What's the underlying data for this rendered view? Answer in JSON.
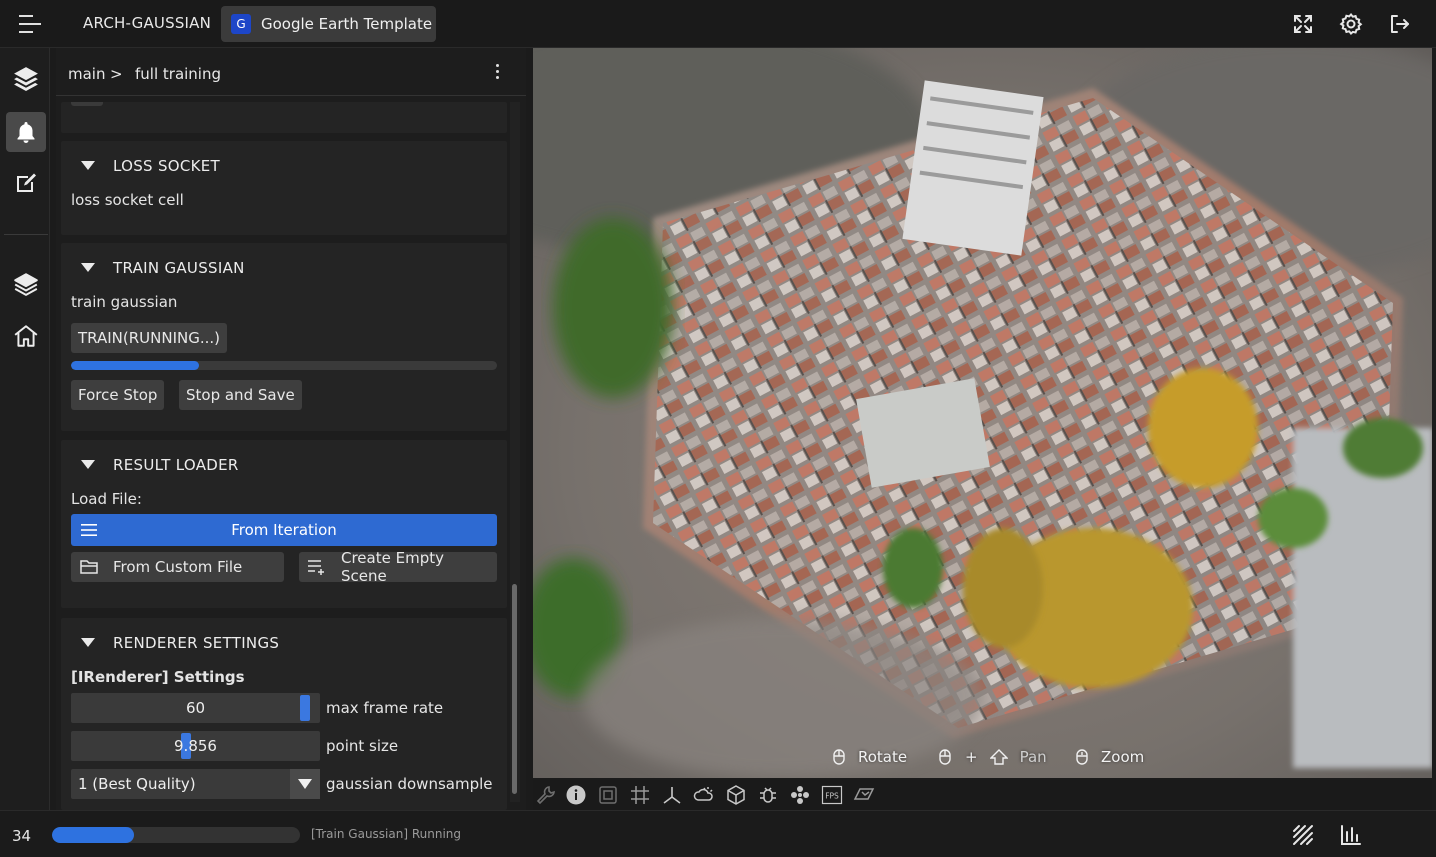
{
  "topbar": {
    "app_title": "ARCH-GAUSSIAN",
    "project_badge": "G",
    "project_name": "Google Earth Template",
    "icons": [
      "menu-icon",
      "fullscreen-icon",
      "gear-icon",
      "logout-icon"
    ]
  },
  "rail": {
    "items": [
      {
        "icon": "layers-icon",
        "active": false
      },
      {
        "icon": "bell-icon",
        "active": true
      },
      {
        "icon": "edit-icon",
        "active": false
      },
      {
        "icon": "layers-icon",
        "active": false
      },
      {
        "icon": "home-icon",
        "active": false
      }
    ]
  },
  "breadcrumb": {
    "root": "main",
    "separator": ">",
    "leaf": "full training"
  },
  "sections": {
    "loss_socket": {
      "title": "LOSS SOCKET",
      "text": "loss socket cell"
    },
    "train_gaussian": {
      "title": "TRAIN GAUSSIAN",
      "text": "train gaussian",
      "train_button": "TRAIN(RUNNING...)",
      "progress": 0.3,
      "force_stop": "Force Stop",
      "stop_and_save": "Stop and Save"
    },
    "result_loader": {
      "title": "RESULT LOADER",
      "load_label": "Load File:",
      "from_iteration": "From Iteration",
      "from_custom_file": "From Custom File",
      "create_empty_scene": "Create Empty Scene"
    },
    "renderer_settings": {
      "title": "RENDERER SETTINGS",
      "subtitle": "[IRenderer] Settings",
      "max_frame_rate": {
        "value": "60",
        "label": "max frame rate",
        "level": 0.96
      },
      "point_size": {
        "value": "9.856",
        "label": "point size",
        "level": 0.46
      },
      "gaussian_downsample": {
        "value": "1 (Best Quality)",
        "label": "gaussian downsample"
      }
    }
  },
  "viewport": {
    "hints": {
      "rotate": "Rotate",
      "plus": "+",
      "pan": "Pan",
      "zoom": "Zoom"
    }
  },
  "toolstrip": {
    "icons": [
      "wrench-icon",
      "info-icon",
      "frame-icon",
      "grid-icon",
      "axes-icon",
      "weather-icon",
      "cube-icon",
      "bug-icon",
      "cluster-icon",
      "fps-icon",
      "plane-icon"
    ],
    "fps_label": "FPS"
  },
  "status": {
    "count": "34",
    "progress": 0.33,
    "text": "[Train Gaussian] Running"
  },
  "colors": {
    "accent": "#2e6ad2",
    "background": "#1b1b1b",
    "card": "#242424"
  }
}
